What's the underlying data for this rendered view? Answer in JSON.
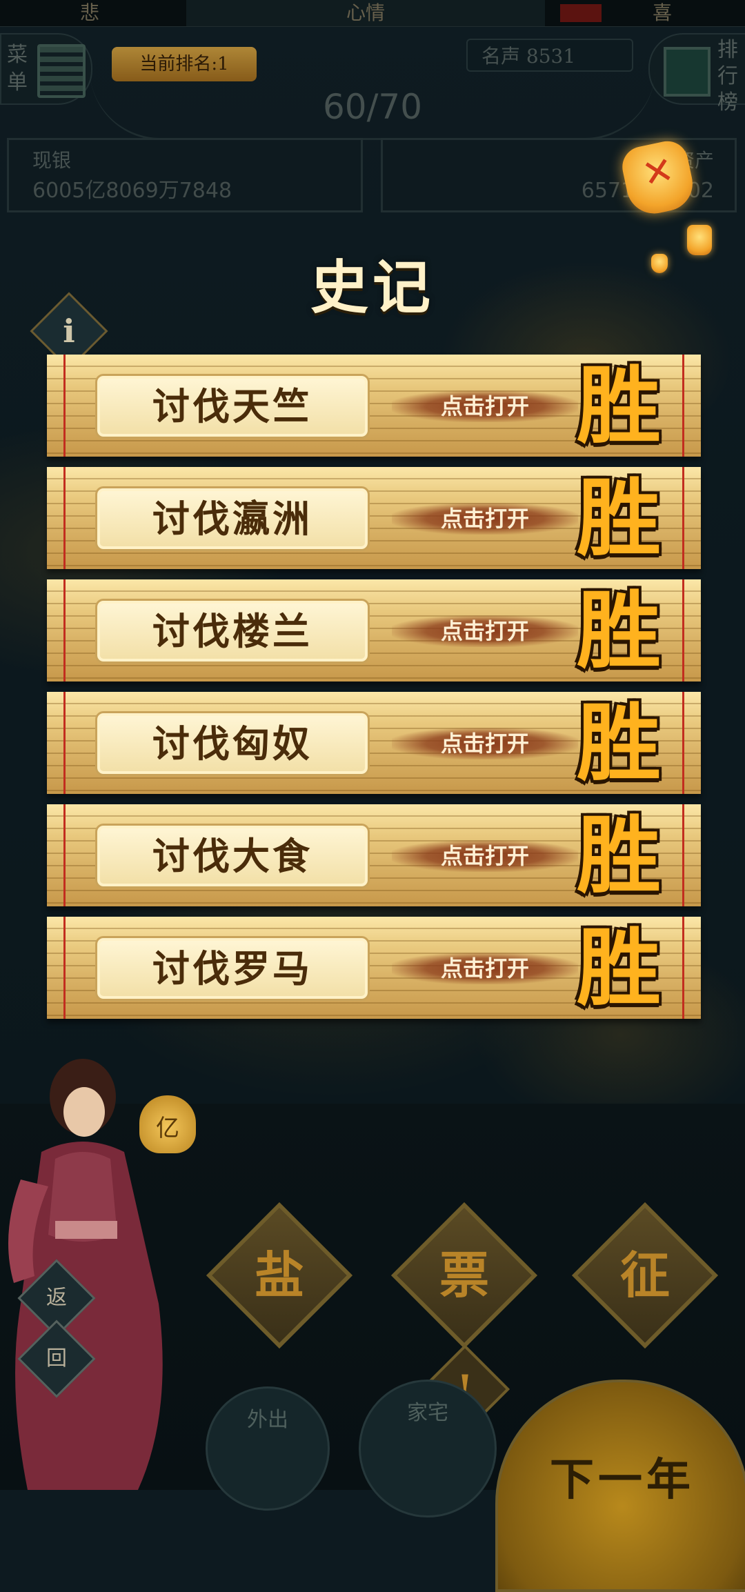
{
  "mood_bar": {
    "left": "悲",
    "center": "心情",
    "right": "喜",
    "level_color": "#7a1a16"
  },
  "menu_button": {
    "label": "菜单"
  },
  "rank_badge": {
    "label": "当前排名:1"
  },
  "fame": {
    "label": "名声 8531"
  },
  "rank_list_button": {
    "label": "排行榜"
  },
  "progress": {
    "text": "60/70"
  },
  "cash": {
    "label": "现银",
    "value": "6005亿8069万7848"
  },
  "assets": {
    "label": "资产",
    "value": "6571亿21  02"
  },
  "close_icon": "lantern-x-icon",
  "title": "史记",
  "records": [
    {
      "name": "讨伐天竺",
      "hint": "点击打开",
      "result": "胜"
    },
    {
      "name": "讨伐瀛洲",
      "hint": "点击打开",
      "result": "胜"
    },
    {
      "name": "讨伐楼兰",
      "hint": "点击打开",
      "result": "胜"
    },
    {
      "name": "讨伐匈奴",
      "hint": "点击打开",
      "result": "胜"
    },
    {
      "name": "讨伐大食",
      "hint": "点击打开",
      "result": "胜"
    },
    {
      "name": "讨伐罗马",
      "hint": "点击打开",
      "result": "胜"
    }
  ],
  "bottom": {
    "money_bag": "亿",
    "back_top": "返",
    "back_bottom": "回",
    "actions": [
      "盐",
      "票",
      "征"
    ],
    "warn": "!",
    "outing": "外出",
    "home": "家宅",
    "next_year": "下一年"
  },
  "colors": {
    "accent_gold": "#ffb21e",
    "scroll": "#e9c97e",
    "red_rule": "#c22d1f"
  }
}
